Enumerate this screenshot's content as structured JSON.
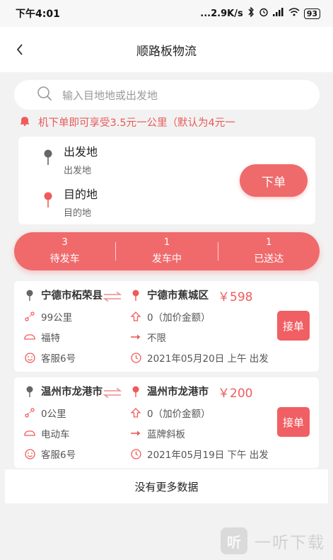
{
  "status_bar": {
    "time": "下午4:01",
    "network_speed": "...2.9K/s",
    "battery": "93"
  },
  "header": {
    "title": "顺路板物流"
  },
  "search": {
    "placeholder": "输入目地地或出发地"
  },
  "notice": {
    "text": "机下单即可享受3.5元一公里（默认为4元一"
  },
  "route": {
    "origin_label": "出发地",
    "origin_value": "出发地",
    "destination_label": "目的地",
    "destination_value": "目的地",
    "order_button": "下单"
  },
  "tabs": [
    {
      "count": "3",
      "label": "待发车"
    },
    {
      "count": "1",
      "label": "发车中"
    },
    {
      "count": "1",
      "label": "已送达"
    }
  ],
  "orders": [
    {
      "from": "宁德市柘荣县",
      "to": "宁德市蕉城区",
      "price": "￥598",
      "distance": "99公里",
      "extra_fee": "0（加价金额）",
      "vehicle": "福特",
      "plate": "不限",
      "service": "客服6号",
      "time": "2021年05月20日 上午 出发",
      "accept_label": "接单"
    },
    {
      "from": "温州市龙港市",
      "to": "温州市龙港市",
      "price": "￥200",
      "distance": "0公里",
      "extra_fee": "0（加价金额）",
      "vehicle": "电动车",
      "plate": "蓝牌斜板",
      "service": "客服6号",
      "time": "2021年05月19日 下午 出发",
      "accept_label": "接单"
    }
  ],
  "footer": {
    "no_more": "没有更多数据"
  },
  "watermark": {
    "text": "一听下载",
    "logo": "听"
  },
  "colors": {
    "accent": "#ef6b6b",
    "price": "#ef5b5b",
    "pin_origin": "#666666",
    "pin_destination": "#ef5b5b"
  }
}
